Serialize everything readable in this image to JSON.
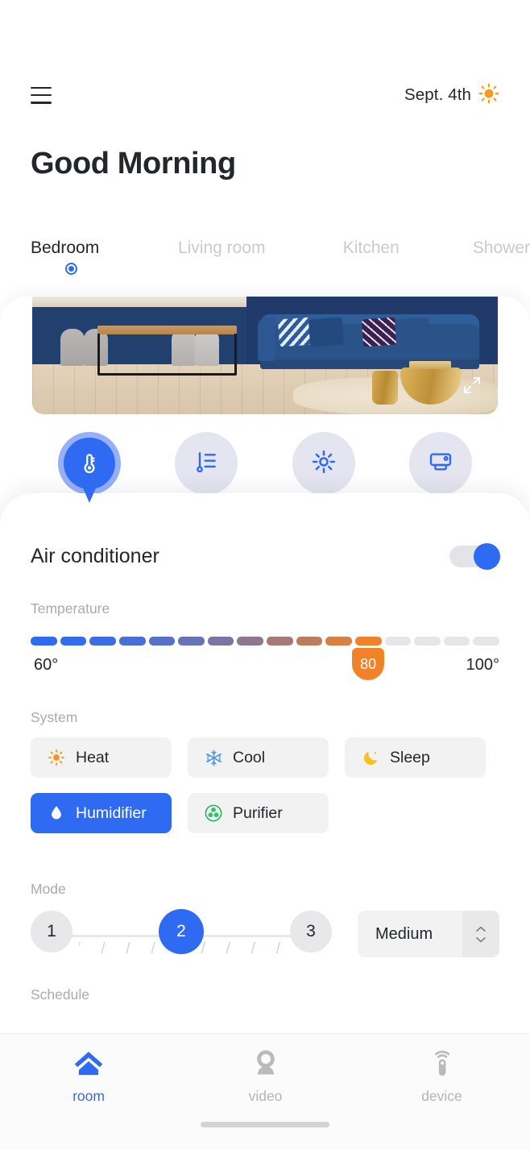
{
  "header": {
    "menu_icon": "hamburger-icon",
    "date": "Sept. 4th",
    "weather_icon": "sun-icon",
    "greeting": "Good Morning"
  },
  "room_tabs": {
    "active_index": 0,
    "items": [
      {
        "label": "Bedroom",
        "active": true
      },
      {
        "label": "Living room",
        "active": false
      },
      {
        "label": "Kitchen",
        "active": false
      },
      {
        "label": "Shower",
        "active": false
      }
    ]
  },
  "photo": {
    "expand_icon": "expand-icon"
  },
  "device_icons": [
    {
      "name": "thermometer-icon",
      "active": true
    },
    {
      "name": "humidity-levels-icon",
      "active": false
    },
    {
      "name": "brightness-icon",
      "active": false
    },
    {
      "name": "projector-icon",
      "active": false
    }
  ],
  "panel": {
    "title": "Air conditioner",
    "power_on": true,
    "temperature": {
      "label": "Temperature",
      "min_label": "60°",
      "max_label": "100°",
      "value": "80",
      "min": 60,
      "max": 100,
      "segments_total": 16,
      "segments_filled": 12
    },
    "system": {
      "label": "System",
      "options": [
        {
          "label": "Heat",
          "icon": "sun-icon",
          "selected": false
        },
        {
          "label": "Cool",
          "icon": "snowflake-icon",
          "selected": false
        },
        {
          "label": "Sleep",
          "icon": "moon-icon",
          "selected": false
        },
        {
          "label": "Humidifier",
          "icon": "water-drop-icon",
          "selected": true
        },
        {
          "label": "Purifier",
          "icon": "fan-icon",
          "selected": false
        }
      ]
    },
    "mode": {
      "label": "Mode",
      "stops": [
        "1",
        "2",
        "3"
      ],
      "selected": "2",
      "speed_value": "Medium"
    },
    "schedule": {
      "label": "Schedule"
    }
  },
  "bottom_nav": {
    "items": [
      {
        "label": "room",
        "icon": "home-icon",
        "active": true
      },
      {
        "label": "video",
        "icon": "camera-icon",
        "active": false
      },
      {
        "label": "device",
        "icon": "remote-icon",
        "active": false
      }
    ]
  },
  "colors": {
    "accent": "#2f6bf2",
    "warm": "#f2822a",
    "text": "#23262b",
    "muted": "#a9aaae",
    "surface": "#f2f2f3"
  }
}
